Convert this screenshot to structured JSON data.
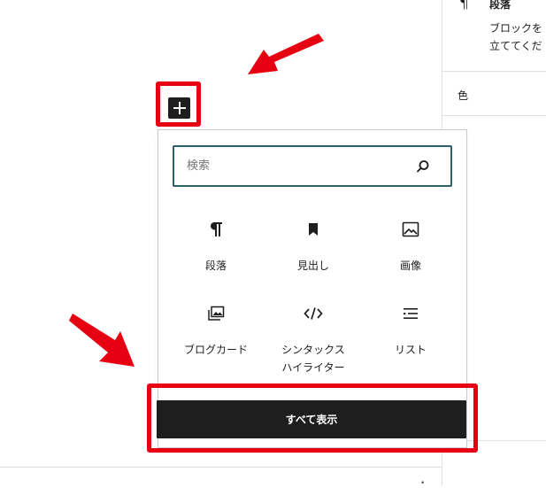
{
  "sidebar": {
    "block_icon": "¶",
    "block_title": "段落",
    "block_desc_line1": "ブロックを",
    "block_desc_line2": "立ててくだ",
    "color_label": "色"
  },
  "inserter": {
    "search_placeholder": "検索",
    "blocks": [
      {
        "label": "段落",
        "icon": "paragraph-icon"
      },
      {
        "label": "見出し",
        "icon": "heading-bookmark-icon"
      },
      {
        "label": "画像",
        "icon": "image-icon"
      },
      {
        "label": "ブログカード",
        "icon": "gallery-icon"
      },
      {
        "label": "シンタックス\nハイライター",
        "icon": "code-icon"
      },
      {
        "label": "リスト",
        "icon": "list-icon"
      }
    ],
    "show_all_label": "すべて表示"
  },
  "colors": {
    "highlight": "#e60012",
    "dark": "#1e1e1e",
    "search_border": "#2c5f6b"
  }
}
